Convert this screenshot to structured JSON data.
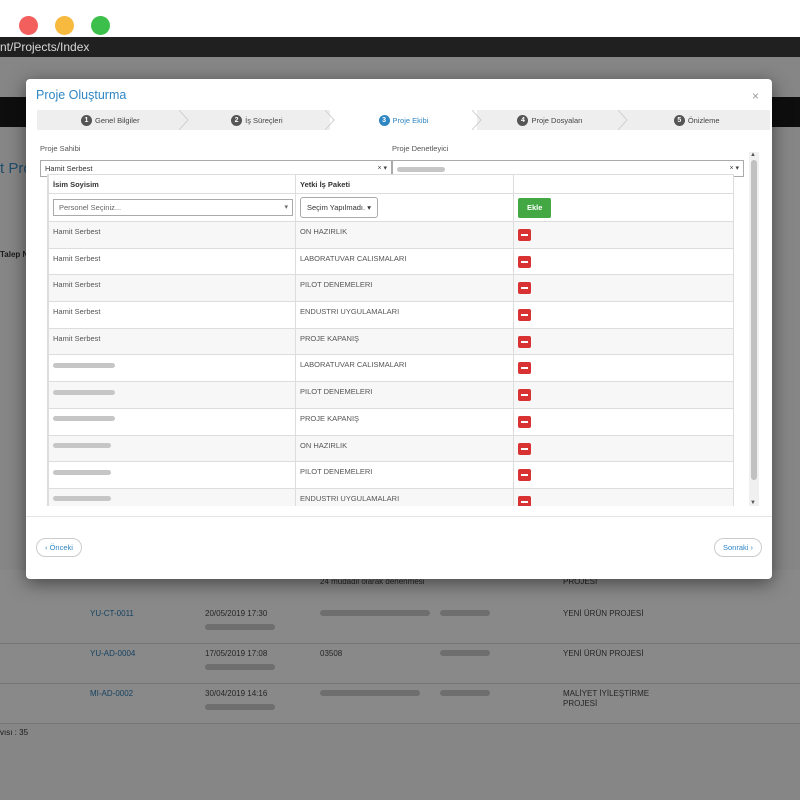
{
  "browser": {
    "url_fragment": "nt/Projects/Index"
  },
  "background": {
    "page_title": "t Pro",
    "column_header": "Talep N",
    "total_label": "vısı : 35",
    "rows": [
      {
        "code": "",
        "date": "",
        "desc": "24 müdadil olarak denenmesi",
        "type": "PROJESİ"
      },
      {
        "code": "YU-CT-0011",
        "date": "20/05/2019 17:30",
        "desc": "",
        "type": "YENİ ÜRÜN PROJESİ"
      },
      {
        "code": "YU-AD-0004",
        "date": "17/05/2019 17:08",
        "desc": "03508",
        "type": "YENİ ÜRÜN PROJESİ"
      },
      {
        "code": "MI-AD-0002",
        "date": "30/04/2019 14:16",
        "desc": "",
        "type": "MALİYET İYİLEŞTİRME PROJESİ"
      }
    ]
  },
  "modal": {
    "title": "Proje Oluşturma",
    "close_icon": "×",
    "steps": [
      {
        "num": "1",
        "label": "Genel Bilgiler"
      },
      {
        "num": "2",
        "label": "İş Süreçleri"
      },
      {
        "num": "3",
        "label": "Proje Ekibi"
      },
      {
        "num": "4",
        "label": "Proje Dosyaları"
      },
      {
        "num": "5",
        "label": "Önizleme"
      }
    ],
    "owner_label": "Proje Sahibi",
    "owner_value": "Hamit Serbest",
    "supervisor_label": "Proje Denetleyici",
    "supervisor_value": "",
    "table": {
      "col_name": "İsim Soyisim",
      "col_package": "Yetki İş Paketi",
      "person_placeholder": "Personel Seçiniz...",
      "package_placeholder": "Seçim Yapılmadı.",
      "add_label": "Ekle",
      "rows": [
        {
          "name": "Hamit Serbest",
          "package": "ON HAZIRLIK"
        },
        {
          "name": "Hamit Serbest",
          "package": "LABORATUVAR CALISMALARI"
        },
        {
          "name": "Hamit Serbest",
          "package": "PILOT DENEMELERI"
        },
        {
          "name": "Hamit Serbest",
          "package": "ENDUSTRI UYGULAMALARI"
        },
        {
          "name": "Hamit Serbest",
          "package": "PROJE KAPANIŞ"
        },
        {
          "name": "",
          "package": "LABORATUVAR CALISMALARI"
        },
        {
          "name": "",
          "package": "PILOT DENEMELERI"
        },
        {
          "name": "",
          "package": "PROJE KAPANIŞ"
        },
        {
          "name": "",
          "package": "ON HAZIRLIK"
        },
        {
          "name": "",
          "package": "PILOT DENEMELERI"
        },
        {
          "name": "",
          "package": "ENDUSTRI UYGULAMALARI"
        }
      ]
    },
    "prev_label": "‹ Önceki",
    "next_label": "Sonraki ›"
  },
  "colors": {
    "accent": "#2f86c4",
    "danger": "#d83232",
    "success": "#43a743"
  }
}
